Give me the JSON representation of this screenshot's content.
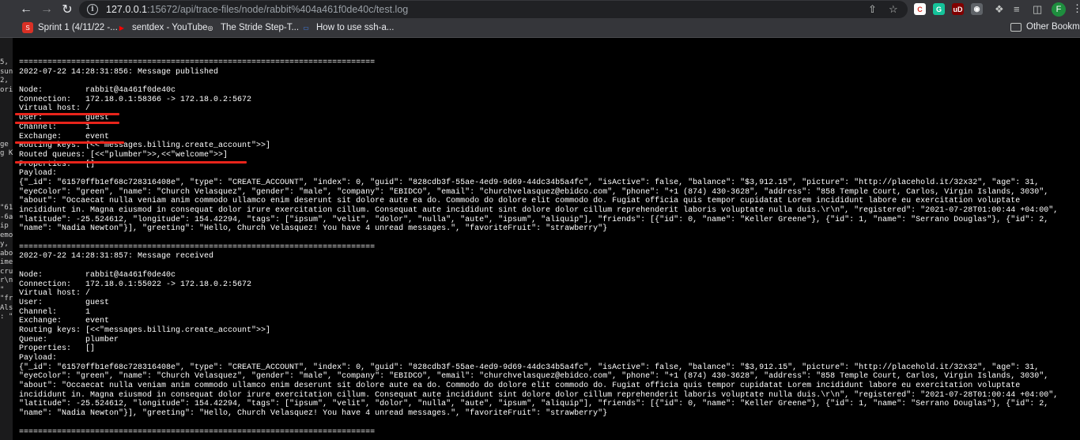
{
  "browser": {
    "url_host": "127.0.0.1",
    "url_path": ":15672/api/trace-files/node/rabbit%404a461f0de40c/test.log",
    "avatar_initial": "F",
    "extensions": [
      {
        "name": "ext-c-icon",
        "color": "#ffffff",
        "glyph": "C",
        "text_color": "#d93025"
      },
      {
        "name": "ext-grammarly-icon",
        "color": "#15c39a",
        "glyph": "G",
        "text_color": "#ffffff"
      },
      {
        "name": "ext-ublock-icon",
        "color": "#800000",
        "glyph": "uD",
        "text_color": "#ffffff"
      },
      {
        "name": "ext-target-icon",
        "color": "#5f6368",
        "glyph": "◉",
        "text_color": "#ffffff"
      }
    ]
  },
  "bookmarks": [
    {
      "label": "Sprint 1 (4/11/22 -...",
      "icon": "jira-icon",
      "color": "#ffffff"
    },
    {
      "label": "sentdex - YouTube",
      "icon": "youtube-icon",
      "color": "#ff0000"
    },
    {
      "label": "The Stride Step-T...",
      "icon": "stride-icon",
      "color": "#ffffff"
    },
    {
      "label": "How to use ssh-a...",
      "icon": "doc-icon",
      "color": "#4285f4"
    }
  ],
  "other_bookmarks": "Other Bookmarks",
  "sliver_lines": [
    "5,",
    "sun",
    "2,",
    "ori",
    "",
    "",
    "",
    "",
    "",
    "ge",
    "g K",
    "",
    "",
    "",
    "",
    "",
    "\"61",
    "-6a",
    "ip",
    "emo",
    "y,",
    "abo",
    "ime",
    "cru",
    "r\\n",
    "\"",
    "\"fr",
    "Als",
    ": \""
  ],
  "log_lines": [
    "===========================================================================",
    "2022-07-22 14:28:31:856: Message published",
    "",
    "Node:         rabbit@4a461f0de40c",
    "Connection:   172.18.0.1:58366 -> 172.18.0.2:5672",
    "Virtual host: /",
    "User:         guest",
    "Channel:      1",
    "Exchange:     event",
    "Routing keys: [<<\"messages.billing.create_account\">>]",
    "Routed queues: [<<\"plumber\">>,<<\"welcome\">>]",
    "Properties:   []",
    "Payload:",
    "{\"_id\": \"61570ffb1ef68c728316408e\", \"type\": \"CREATE_ACCOUNT\", \"index\": 0, \"guid\": \"828cdb3f-55ae-4ed9-9d69-44dc34b5a4fc\", \"isActive\": false, \"balance\": \"$3,912.15\", \"picture\": \"http://placehold.it/32x32\", \"age\": 31,",
    "\"eyeColor\": \"green\", \"name\": \"Church Velasquez\", \"gender\": \"male\", \"company\": \"EBIDCO\", \"email\": \"churchvelasquez@ebidco.com\", \"phone\": \"+1 (874) 430-3628\", \"address\": \"858 Temple Court, Carlos, Virgin Islands, 3030\",",
    "\"about\": \"Occaecat nulla veniam anim commodo ullamco enim deserunt sit dolore aute ea do. Commodo do dolore elit commodo do. Fugiat officia quis tempor cupidatat Lorem incididunt labore eu exercitation voluptate",
    "incididunt in. Magna eiusmod in consequat dolor irure exercitation cillum. Consequat aute incididunt sint dolore dolor cillum reprehenderit laboris voluptate nulla duis.\\r\\n\", \"registered\": \"2021-07-28T01:00:44 +04:00\",",
    "\"latitude\": -25.524612, \"longitude\": 154.42294, \"tags\": [\"ipsum\", \"velit\", \"dolor\", \"nulla\", \"aute\", \"ipsum\", \"aliquip\"], \"friends\": [{\"id\": 0, \"name\": \"Keller Greene\"}, {\"id\": 1, \"name\": \"Serrano Douglas\"}, {\"id\": 2,",
    "\"name\": \"Nadia Newton\"}], \"greeting\": \"Hello, Church Velasquez! You have 4 unread messages.\", \"favoriteFruit\": \"strawberry\"}",
    "",
    "===========================================================================",
    "2022-07-22 14:28:31:857: Message received",
    "",
    "Node:         rabbit@4a461f0de40c",
    "Connection:   172.18.0.1:55022 -> 172.18.0.2:5672",
    "Virtual host: /",
    "User:         guest",
    "Channel:      1",
    "Exchange:     event",
    "Routing keys: [<<\"messages.billing.create_account\">>]",
    "Queue:        plumber",
    "Properties:   []",
    "Payload:",
    "{\"_id\": \"61570ffb1ef68c728316408e\", \"type\": \"CREATE_ACCOUNT\", \"index\": 0, \"guid\": \"828cdb3f-55ae-4ed9-9d69-44dc34b5a4fc\", \"isActive\": false, \"balance\": \"$3,912.15\", \"picture\": \"http://placehold.it/32x32\", \"age\": 31,",
    "\"eyeColor\": \"green\", \"name\": \"Church Velasquez\", \"gender\": \"male\", \"company\": \"EBIDCO\", \"email\": \"churchvelasquez@ebidco.com\", \"phone\": \"+1 (874) 430-3628\", \"address\": \"858 Temple Court, Carlos, Virgin Islands, 3030\",",
    "\"about\": \"Occaecat nulla veniam anim commodo ullamco enim deserunt sit dolore aute ea do. Commodo do dolore elit commodo do. Fugiat officia quis tempor cupidatat Lorem incididunt labore eu exercitation voluptate",
    "incididunt in. Magna eiusmod in consequat dolor irure exercitation cillum. Consequat aute incididunt sint dolore dolor cillum reprehenderit laboris voluptate nulla duis.\\r\\n\", \"registered\": \"2021-07-28T01:00:44 +04:00\",",
    "\"latitude\": -25.524612, \"longitude\": 154.42294, \"tags\": [\"ipsum\", \"velit\", \"dolor\", \"nulla\", \"aute\", \"ipsum\", \"aliquip\"], \"friends\": [{\"id\": 0, \"name\": \"Keller Greene\"}, {\"id\": 1, \"name\": \"Serrano Douglas\"}, {\"id\": 2,",
    "\"name\": \"Nadia Newton\"}], \"greeting\": \"Hello, Church Velasquez! You have 4 unread messages.\", \"favoriteFruit\": \"strawberry\"}",
    "",
    "==========================================================================="
  ],
  "highlight_color": "#e8241b"
}
